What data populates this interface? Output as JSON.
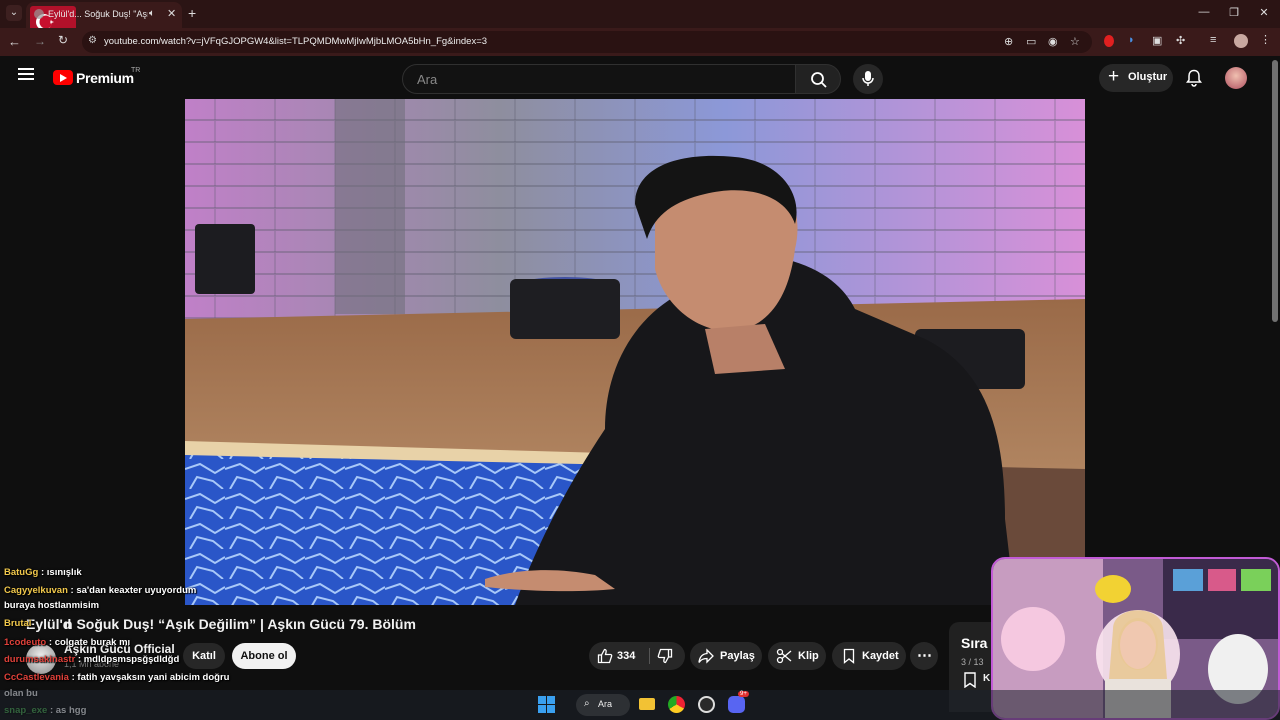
{
  "browser": {
    "tab_title": "Eylül'd... Soğuk Duş! \"Aşık",
    "url": "youtube.com/watch?v=jVFqGJOPGW4&list=TLPQMDMwMjIwMjbLMOA5bHn_Fg&index=3",
    "icons": [
      "tab-list-icon",
      "audio-icon",
      "close-icon",
      "plus-icon",
      "minimize-icon",
      "maximize-icon",
      "close-window-icon",
      "back-icon",
      "site-info-icon",
      "zoom-icon",
      "cast-icon",
      "eye-off-icon",
      "star-icon",
      "extension-icon"
    ]
  },
  "youtube": {
    "logo_label": "Premium",
    "region": "TR",
    "search_placeholder": "Ara",
    "create_label": "Oluştur",
    "video": {
      "title_prefix": "Eylül'd",
      "title": "n Soğuk Duş! “Aşık Değilim” | Aşkın Gücü 79. Bölüm",
      "channel": "Aşkın Gücü Official",
      "subscribers": "1,1 Mn abone",
      "join_label": "Katıl",
      "subscribe_label": "Abone ol",
      "like_count": "334",
      "share_label": "Paylaş",
      "clip_label": "Klip",
      "save_label": "Kaydet"
    },
    "queue": {
      "title": "Sıra",
      "count": "3 / 13",
      "save_label": "K"
    }
  },
  "chat": [
    {
      "user": "BatuGg",
      "color": "#f2c94c",
      "text": "ısınışlık"
    },
    {
      "user": "Cagyyelkuvan",
      "color": "#f2c94c",
      "text": "sa'dan keaxter uyuyordum"
    },
    {
      "user": "",
      "color": "#ffffff",
      "text": "buraya hostlanmisim"
    },
    {
      "user": "Brutal",
      "color": "#f2c94c",
      "text": ""
    },
    {
      "user": "1codeuto",
      "color": "#e0413a",
      "text": "colgate burak mı"
    },
    {
      "user": "durumsakinastr",
      "color": "#e0413a",
      "text": "mdldpsmspsğşdldğd"
    },
    {
      "user": "CcCastlevania",
      "color": "#e0413a",
      "text": "fatih yavşaksın yani abicim doğru"
    },
    {
      "user": "",
      "color": "#ffffff",
      "text": "olan bu"
    },
    {
      "user": "snap_exe",
      "color": "#4caf50",
      "text": "as hgg"
    }
  ],
  "taskbar": {
    "search_label": "Ara",
    "badge": "9+"
  },
  "colors": {
    "accent": "#ff0000",
    "webcam_border": "#c25bd6",
    "browser_frame": "#3a1a1a"
  }
}
